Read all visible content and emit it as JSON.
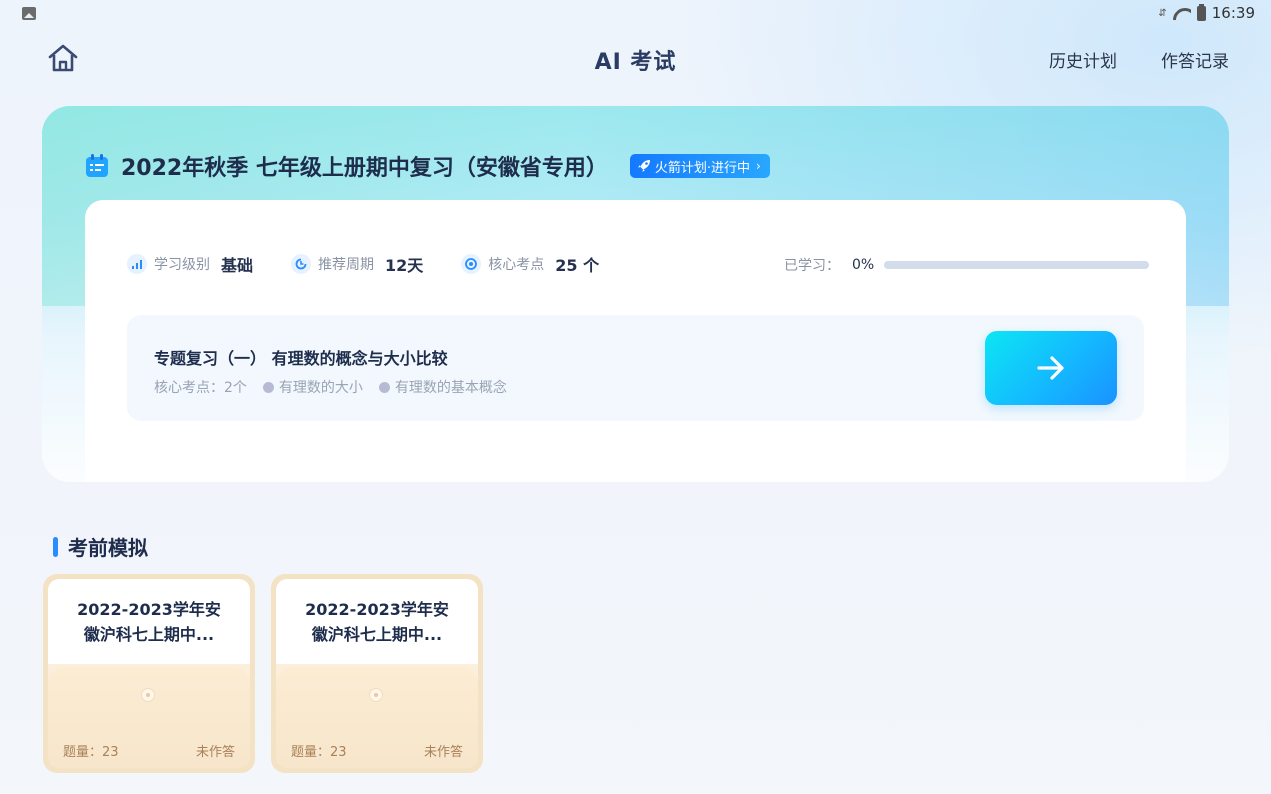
{
  "status_bar": {
    "time": "16:39"
  },
  "header": {
    "title": "AI 考试",
    "nav": [
      "历史计划",
      "作答记录"
    ]
  },
  "plan": {
    "title": "2022年秋季 七年级上册期中复习（安徽省专用）",
    "badge": "火箭计划·进行中",
    "stats": [
      {
        "label": "学习级别",
        "value": "基础",
        "icon": "signal-bars-icon"
      },
      {
        "label": "推荐周期",
        "value": "12天",
        "icon": "cycle-icon"
      },
      {
        "label": "核心考点",
        "value": "25 个",
        "icon": "target-icon"
      }
    ],
    "progress_label": "已学习：",
    "progress_value": "0%",
    "progress_fraction": 0,
    "topic": {
      "title": "专题复习（一） 有理数的概念与大小比较",
      "points_label": "核心考点：2个",
      "points": [
        "有理数的大小",
        "有理数的基本概念"
      ]
    }
  },
  "section": {
    "title": "考前模拟",
    "cards": [
      {
        "title_line1": "2022-2023学年安",
        "title_line2": "徽沪科七上期中...",
        "count": "题量：23",
        "status": "未作答"
      },
      {
        "title_line1": "2022-2023学年安",
        "title_line2": "徽沪科七上期中...",
        "count": "题量：23",
        "status": "未作答"
      }
    ]
  },
  "colors": {
    "accent": "#2a8cff",
    "title": "#1f2d4d",
    "card_border": "#f4e2c4"
  }
}
